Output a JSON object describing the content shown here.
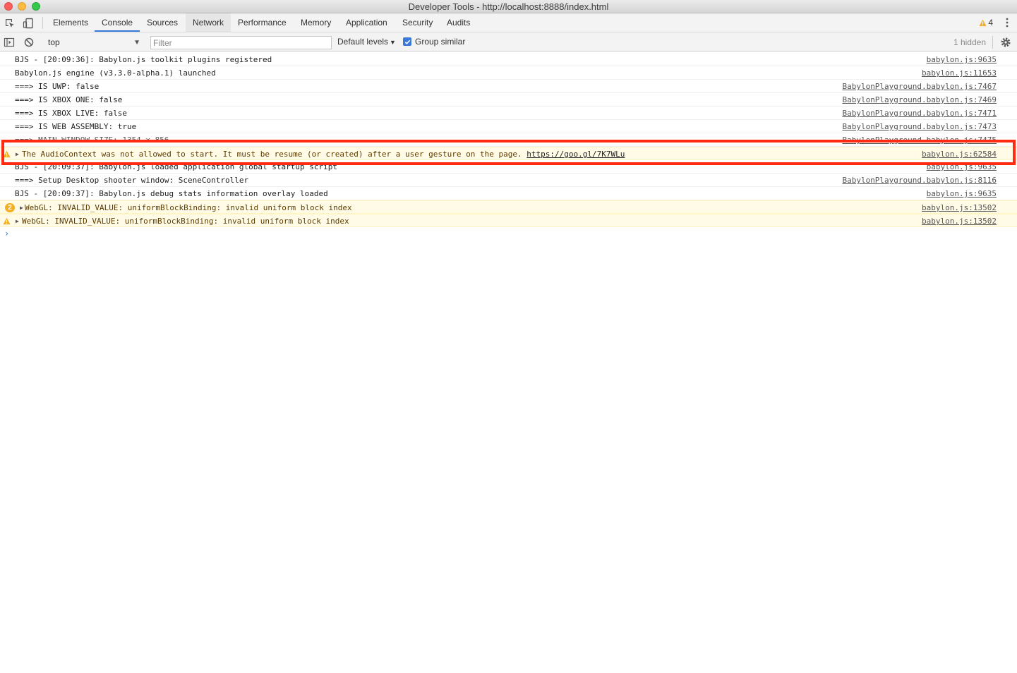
{
  "window": {
    "title": "Developer Tools - http://localhost:8888/index.html"
  },
  "tabs": [
    {
      "label": "Elements"
    },
    {
      "label": "Console"
    },
    {
      "label": "Sources"
    },
    {
      "label": "Network"
    },
    {
      "label": "Performance"
    },
    {
      "label": "Memory"
    },
    {
      "label": "Application"
    },
    {
      "label": "Security"
    },
    {
      "label": "Audits"
    }
  ],
  "tabbar": {
    "selected_tab": "Console",
    "warning_count": "4",
    "icons": [
      "inspect-element-icon",
      "device-toolbar-icon",
      "warning-icon",
      "more-options-icon"
    ]
  },
  "toolbar": {
    "context": "top",
    "filter_placeholder": "Filter",
    "filter_value": "",
    "levels_label": "Default levels",
    "group_similar_label": "Group similar",
    "group_similar_checked": true,
    "hidden_label": "1 hidden",
    "icons": [
      "show-sidebar-icon",
      "clear-console-icon",
      "dropdown-arrow-icon",
      "settings-gear-icon"
    ]
  },
  "messages": [
    {
      "text": "BJS - [20:09:36]: Babylon.js toolkit plugins registered",
      "source": "babylon.js:9635"
    },
    {
      "text": "Babylon.js engine (v3.3.0-alpha.1) launched",
      "source": "babylon.js:11653"
    },
    {
      "text": "===> IS UWP: false",
      "source": "BabylonPlayground.babylon.js:7467"
    },
    {
      "text": "===> IS XBOX ONE: false",
      "source": "BabylonPlayground.babylon.js:7469"
    },
    {
      "text": "===> IS XBOX LIVE: false",
      "source": "BabylonPlayground.babylon.js:7471"
    },
    {
      "text": "===> IS WEB ASSEMBLY: true",
      "source": "BabylonPlayground.babylon.js:7473"
    },
    {
      "text": "===> MAIN WINDOW SIZE: 1354 x 856",
      "source": "BabylonPlayground.babylon.js:7475"
    },
    {
      "text": "The AudioContext was not allowed to start. It must be resume (or created) after a user gesture on the page. ",
      "link": "https://goo.gl/7K7WLu",
      "source": "babylon.js:62584"
    },
    {
      "text": "BJS - [20:09:37]: Babylon.js loaded application global startup script",
      "source": "babylon.js:9635"
    },
    {
      "text": "===> Setup Desktop shooter window: SceneController",
      "source": "BabylonPlayground.babylon.js:8116"
    },
    {
      "text": "BJS - [20:09:37]: Babylon.js debug stats information overlay loaded",
      "source": "babylon.js:9635"
    },
    {
      "count": "2",
      "text": "WebGL: INVALID_VALUE: uniformBlockBinding: invalid uniform block index",
      "source": "babylon.js:13502"
    },
    {
      "text": "WebGL: INVALID_VALUE: uniformBlockBinding: invalid uniform block index",
      "source": "babylon.js:13502"
    }
  ],
  "prompt": {
    "symbol": "›"
  },
  "colors": {
    "accent": "#3879d9",
    "warning_bg": "#fffbe6",
    "warning_icon": "#f2b026",
    "highlight": "#ff2a12"
  }
}
